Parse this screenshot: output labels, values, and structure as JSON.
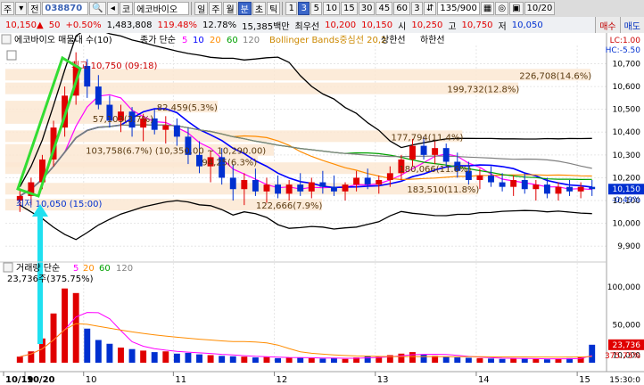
{
  "toolbar": {
    "menu_label": "주",
    "nav_label": "전",
    "code": "038870",
    "market": "코",
    "name": "에코바이오",
    "periods": [
      "일",
      "주",
      "월",
      "분",
      "초",
      "틱"
    ],
    "active_period": "분",
    "minutes": [
      "1",
      "3",
      "5",
      "10",
      "15",
      "30",
      "45",
      "60"
    ],
    "active_minute": "3",
    "count_value": "3",
    "counter": "135/900",
    "date": "10/20"
  },
  "quote": {
    "price": "10,150",
    "change": "50",
    "change_rate": "+0.50%",
    "volume": "1,483,808",
    "volume_ratio": "119.48%",
    "turnover": "12.78%",
    "amount": "15,385백만",
    "best_ask_label": "최우선",
    "best_ask": "10,200",
    "best_bid": "10,150",
    "open_label": "시",
    "open": "10,250",
    "high_label": "고",
    "high": "10,750",
    "low_label": "저",
    "low": "10,050",
    "buy_label": "매수",
    "sell_label": "매도"
  },
  "legend": {
    "title": "에코바이오 매물대 수(10)",
    "ma_label": "종가 단순",
    "ma_periods": [
      "5",
      "10",
      "20",
      "60",
      "120"
    ],
    "bollinger": "Bollinger Bands중심선 20,2",
    "upper": "상한선",
    "lower": "하한선",
    "lc": "LC:1.00",
    "hc": "HC:-5.50"
  },
  "annotations": {
    "high": "최고 10,750 (09:18)",
    "low": "최저 10,050 (15:00)",
    "vp": [
      {
        "text": "226,708(14.6%)",
        "price": 10650
      },
      {
        "text": "199,732(12.8%)",
        "price": 10590
      },
      {
        "text": "82,459(5.3%)",
        "price": 10510
      },
      {
        "text": "57,103(3.7%)",
        "price": 10460
      },
      {
        "text": "177,794(11.4%)",
        "price": 10380
      },
      {
        "text": "103,758(6.7%) (10,350.00 ~ 10,290.00)",
        "price": 10320
      },
      {
        "text": "94,25(6.3%)",
        "price": 10270
      },
      {
        "text": "180,066(11.6%)",
        "price": 10240
      },
      {
        "text": "183,510(11.8%)",
        "price": 10150
      },
      {
        "text": "122,666(7.9%)",
        "price": 10080
      }
    ]
  },
  "price_axis": {
    "ticks": [
      "10,700",
      "10,600",
      "10,500",
      "10,400",
      "10,300",
      "10,200",
      "10,100",
      "10,000",
      "9,900"
    ],
    "current": "10,150",
    "current_rate": "-0.49%"
  },
  "volume_panel": {
    "label": "거래량 단순",
    "ma_periods": [
      "5",
      "20",
      "60",
      "120"
    ],
    "value": "23,736주(375.75%)",
    "ticks": [
      "100,000",
      "50,000",
      "10,000"
    ],
    "current": "23,736",
    "current_pct": "375.75%"
  },
  "time_axis": {
    "labels": [
      "10/19",
      "10/20",
      "10",
      "11",
      "12",
      "13",
      "14",
      "15"
    ],
    "end": "15:30:0"
  },
  "colors": {
    "up": "#e00000",
    "down": "#0030d0",
    "ma5": "#ff00ff",
    "ma10": "#0000ff",
    "ma20": "#ff8c00",
    "ma60": "#00a000",
    "ma120": "#808080",
    "band": "#000000",
    "highlight_green": "#33dd33",
    "arrow_cyan": "#20e0f0",
    "vp_fill": "#fbe8d2"
  },
  "chart_data": {
    "type": "candlestick",
    "price_range": [
      9850,
      10780
    ],
    "volume_range": [
      0,
      120000
    ],
    "candles": [
      [
        10100,
        10150,
        10050,
        10120
      ],
      [
        10120,
        10200,
        10080,
        10180
      ],
      [
        10180,
        10300,
        10150,
        10280
      ],
      [
        10280,
        10450,
        10250,
        10420
      ],
      [
        10420,
        10600,
        10380,
        10560
      ],
      [
        10560,
        10750,
        10520,
        10690
      ],
      [
        10690,
        10720,
        10550,
        10600
      ],
      [
        10600,
        10650,
        10500,
        10520
      ],
      [
        10520,
        10560,
        10420,
        10450
      ],
      [
        10450,
        10520,
        10400,
        10490
      ],
      [
        10490,
        10510,
        10380,
        10420
      ],
      [
        10420,
        10480,
        10360,
        10460
      ],
      [
        10460,
        10500,
        10390,
        10410
      ],
      [
        10410,
        10470,
        10350,
        10430
      ],
      [
        10430,
        10460,
        10340,
        10380
      ],
      [
        10380,
        10420,
        10260,
        10300
      ],
      [
        10300,
        10360,
        10220,
        10250
      ],
      [
        10250,
        10320,
        10180,
        10290
      ],
      [
        10290,
        10330,
        10170,
        10200
      ],
      [
        10200,
        10260,
        10100,
        10150
      ],
      [
        10150,
        10220,
        10080,
        10190
      ],
      [
        10190,
        10240,
        10120,
        10140
      ],
      [
        10140,
        10200,
        10090,
        10170
      ],
      [
        10170,
        10210,
        10110,
        10130
      ],
      [
        10130,
        10190,
        10100,
        10170
      ],
      [
        10170,
        10220,
        10120,
        10140
      ],
      [
        10140,
        10200,
        10110,
        10180
      ],
      [
        10180,
        10230,
        10130,
        10160
      ],
      [
        10160,
        10210,
        10120,
        10140
      ],
      [
        10140,
        10180,
        10100,
        10170
      ],
      [
        10170,
        10230,
        10140,
        10200
      ],
      [
        10200,
        10240,
        10150,
        10170
      ],
      [
        10170,
        10210,
        10130,
        10190
      ],
      [
        10190,
        10250,
        10160,
        10220
      ],
      [
        10220,
        10300,
        10190,
        10280
      ],
      [
        10280,
        10370,
        10250,
        10340
      ],
      [
        10340,
        10380,
        10280,
        10300
      ],
      [
        10300,
        10360,
        10260,
        10330
      ],
      [
        10330,
        10350,
        10250,
        10270
      ],
      [
        10270,
        10310,
        10200,
        10230
      ],
      [
        10230,
        10270,
        10170,
        10190
      ],
      [
        10190,
        10240,
        10150,
        10210
      ],
      [
        10210,
        10250,
        10160,
        10180
      ],
      [
        10180,
        10220,
        10140,
        10160
      ],
      [
        10160,
        10210,
        10120,
        10190
      ],
      [
        10190,
        10220,
        10130,
        10150
      ],
      [
        10150,
        10190,
        10100,
        10170
      ],
      [
        10170,
        10200,
        10110,
        10130
      ],
      [
        10130,
        10180,
        10100,
        10160
      ],
      [
        10160,
        10190,
        10120,
        10140
      ],
      [
        10140,
        10180,
        10110,
        10160
      ],
      [
        10160,
        10190,
        10120,
        10150
      ]
    ],
    "volumes": [
      8000,
      15000,
      32000,
      65000,
      98000,
      92000,
      45000,
      30000,
      25000,
      20000,
      18000,
      16000,
      14000,
      15000,
      12000,
      13000,
      11000,
      10000,
      9000,
      8500,
      8000,
      7000,
      7500,
      6000,
      6500,
      7000,
      6000,
      5500,
      6000,
      5000,
      7000,
      9000,
      8000,
      10000,
      12000,
      14000,
      11000,
      9000,
      8000,
      7000,
      6500,
      6000,
      5500,
      5000,
      6000,
      5500,
      5000,
      4500,
      5000,
      6000,
      8000,
      23736
    ]
  }
}
